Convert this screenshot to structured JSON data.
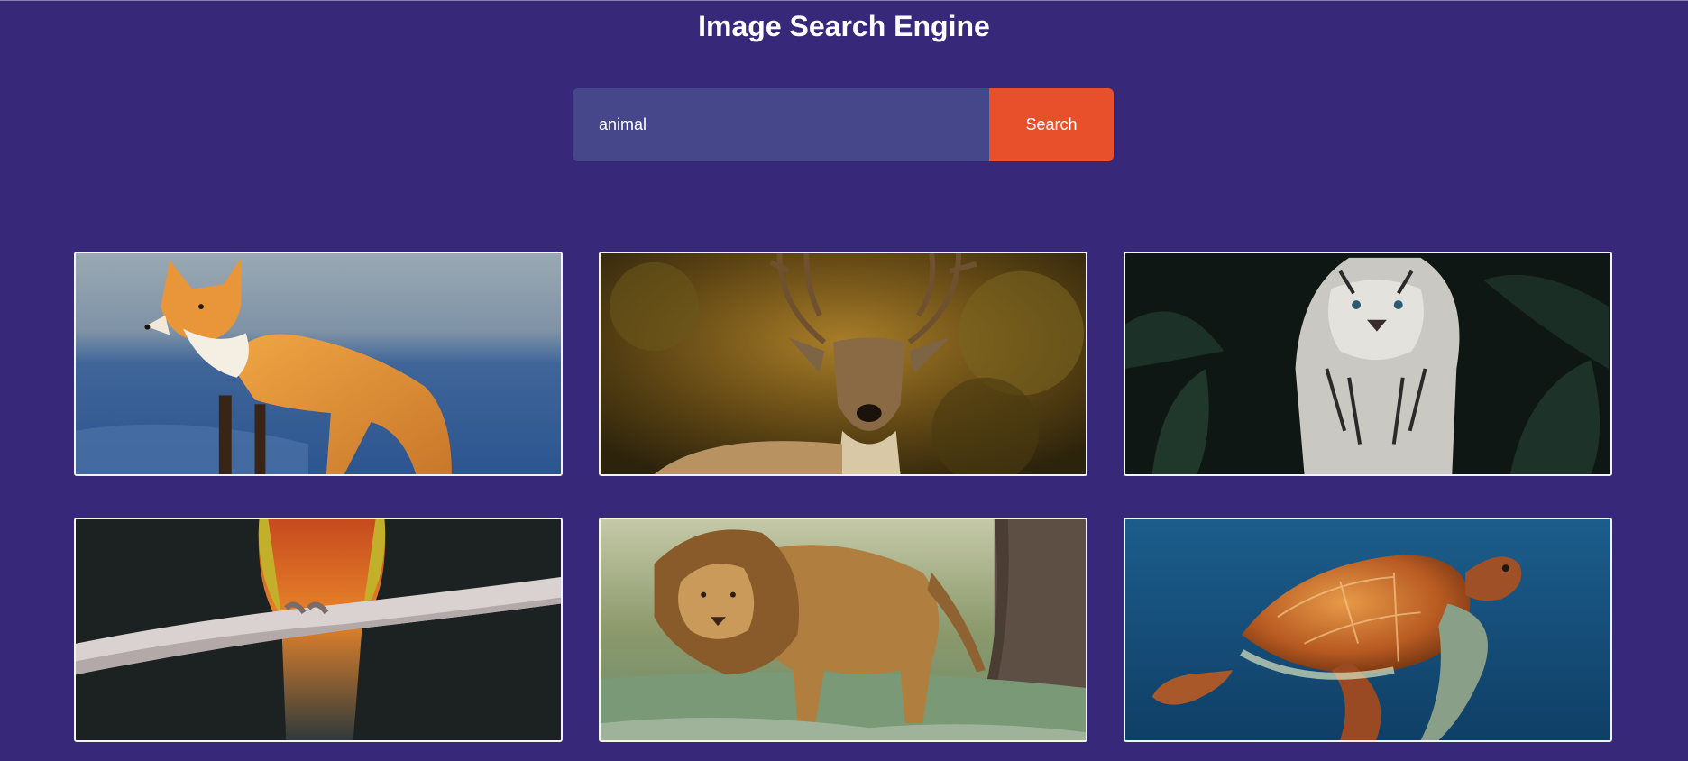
{
  "page": {
    "title": "Image Search Engine"
  },
  "search": {
    "value": "animal",
    "button_label": "Search"
  },
  "results": [
    {
      "subject": "fox"
    },
    {
      "subject": "deer"
    },
    {
      "subject": "white-tiger"
    },
    {
      "subject": "parrot"
    },
    {
      "subject": "lion"
    },
    {
      "subject": "sea-turtle"
    }
  ],
  "colors": {
    "background": "#37287a",
    "input_bg": "#46478a",
    "button_bg": "#e8502c",
    "card_border": "#f3f1fa"
  }
}
